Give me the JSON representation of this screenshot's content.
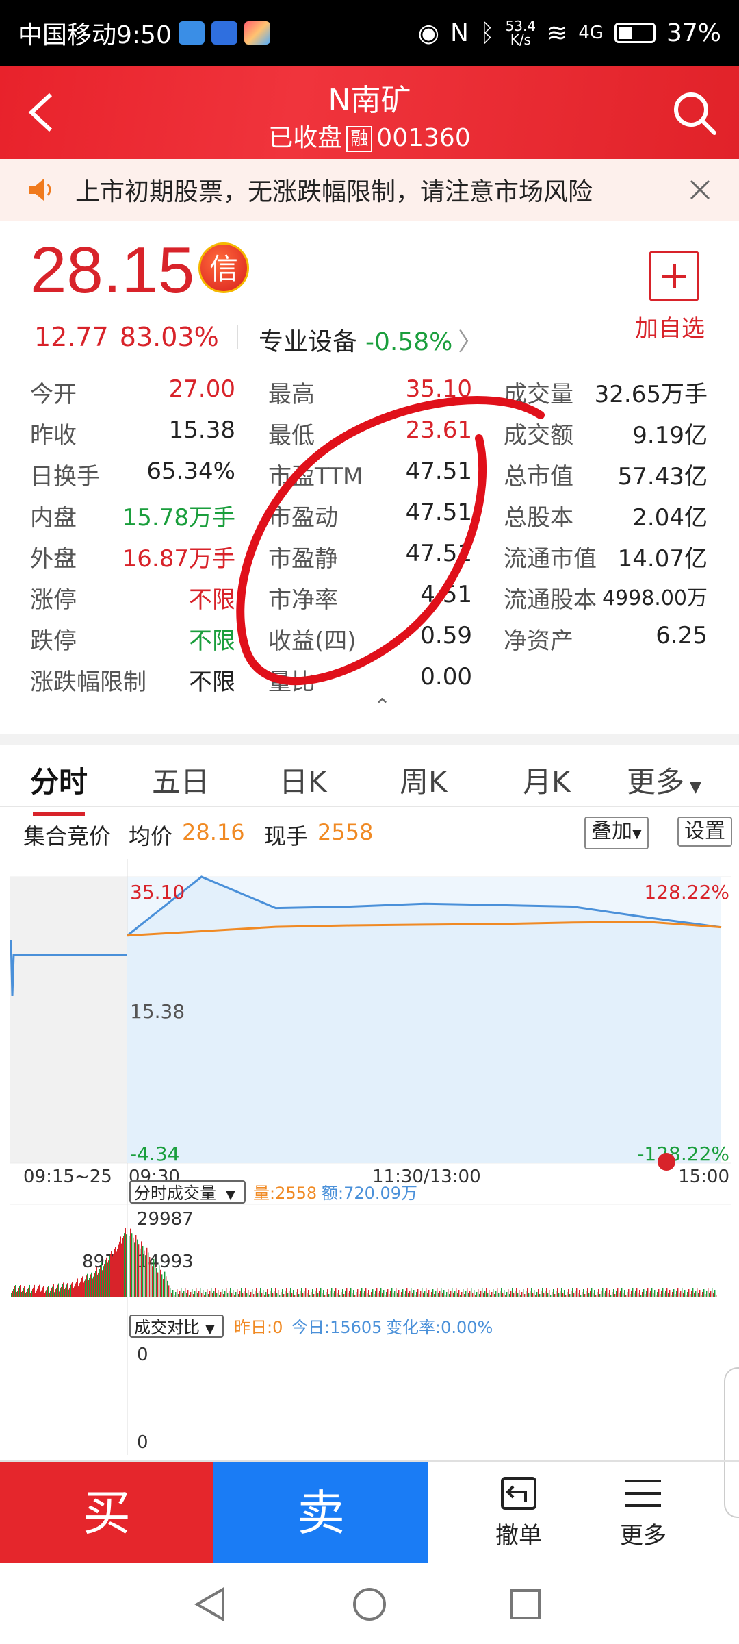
{
  "status": {
    "carrier_time": "中国移动9:50",
    "speed": "53.4\nK/s",
    "net": "4G",
    "battery": "37%"
  },
  "header": {
    "title": "N南矿",
    "state": "已收盘",
    "rong": "融",
    "code": "001360"
  },
  "notice": {
    "text": "上市初期股票，无涨跌幅限制，请注意市场风险"
  },
  "quote": {
    "price": "28.15",
    "badge": "信",
    "change": "12.77",
    "change_pct": "83.03%",
    "sector": "专业设备",
    "sector_pct": "-0.58%",
    "add_label": "加自选"
  },
  "stats": [
    [
      {
        "l": "今开",
        "v": "27.00",
        "c": "red"
      },
      {
        "l": "最高",
        "v": "35.10",
        "c": "red"
      },
      {
        "l": "成交量",
        "v": "32.65万手",
        "c": "dark"
      }
    ],
    [
      {
        "l": "昨收",
        "v": "15.38",
        "c": "dark"
      },
      {
        "l": "最低",
        "v": "23.61",
        "c": "red"
      },
      {
        "l": "成交额",
        "v": "9.19亿",
        "c": "dark"
      }
    ],
    [
      {
        "l": "日换手",
        "v": "65.34%",
        "c": "dark"
      },
      {
        "l": "市盈TTM",
        "v": "47.51",
        "c": "dark"
      },
      {
        "l": "总市值",
        "v": "57.43亿",
        "c": "dark"
      }
    ],
    [
      {
        "l": "内盘",
        "v": "15.78万手",
        "c": "green"
      },
      {
        "l": "市盈动",
        "v": "47.51",
        "c": "dark"
      },
      {
        "l": "总股本",
        "v": "2.04亿",
        "c": "dark"
      }
    ],
    [
      {
        "l": "外盘",
        "v": "16.87万手",
        "c": "red"
      },
      {
        "l": "市盈静",
        "v": "47.51",
        "c": "dark"
      },
      {
        "l": "流通市值",
        "v": "14.07亿",
        "c": "dark"
      }
    ],
    [
      {
        "l": "涨停",
        "v": "不限",
        "c": "red"
      },
      {
        "l": "市净率",
        "v": "4.51",
        "c": "dark"
      },
      {
        "l": "流通股本",
        "v": "4998.00万",
        "c": "dark"
      }
    ],
    [
      {
        "l": "跌停",
        "v": "不限",
        "c": "green"
      },
      {
        "l": "收益(四)",
        "v": "0.59",
        "c": "dark"
      },
      {
        "l": "净资产",
        "v": "6.25",
        "c": "dark"
      }
    ],
    [
      {
        "l": "涨跌幅限制",
        "v": "不限",
        "c": "dark"
      },
      {
        "l": "量比",
        "v": "0.00",
        "c": "dark"
      },
      {
        "l": "",
        "v": "",
        "c": "dark"
      }
    ]
  ],
  "tabs": [
    "分时",
    "五日",
    "日K",
    "周K",
    "月K",
    "更多"
  ],
  "infobar": {
    "auction": "集合竞价",
    "avg_label": "均价",
    "avg": "28.16",
    "now_label": "现手",
    "now": "2558",
    "overlay_btn": "叠加",
    "settings_btn": "设置"
  },
  "chart_labels": {
    "high": "35.10",
    "mid": "15.38",
    "low": "-4.34",
    "up_pct": "128.22%",
    "down_pct": "-128.22%",
    "t1": "09:15~25",
    "t2": "09:30",
    "t3": "11:30/13:00",
    "t4": "15:00"
  },
  "volume": {
    "selector": "分时成交量",
    "vol": "量:2558",
    "amount": "额:720.09万",
    "max": "29987",
    "mid": "14993",
    "left_val": "8978"
  },
  "compare": {
    "selector": "成交对比",
    "yesterday": "昨日:0",
    "today": "今日:15605",
    "rate": "变化率:0.00%",
    "top": "0",
    "bottom": "0"
  },
  "bottom": {
    "buy": "买",
    "sell": "卖",
    "cancel": "撤单",
    "more": "更多"
  },
  "colors": {
    "red": "#d8232a",
    "green": "#1a9e3c",
    "blue": "#1a7cf5",
    "price_line": "#4a90d9",
    "avg_line": "#f08a24"
  },
  "chart_data": {
    "type": "line",
    "x": [
      "09:30",
      "10:00",
      "10:30",
      "11:00",
      "11:30",
      "13:30",
      "14:00",
      "14:30",
      "15:00"
    ],
    "series": [
      {
        "values": [
          27.0,
          35.1,
          30.8,
          31.0,
          31.4,
          31.2,
          31.0,
          29.5,
          28.15
        ]
      },
      {
        "values": [
          27.0,
          27.6,
          28.2,
          28.4,
          28.5,
          28.6,
          28.8,
          28.9,
          28.16
        ]
      }
    ],
    "ylim": [
      -4.34,
      35.1
    ]
  }
}
